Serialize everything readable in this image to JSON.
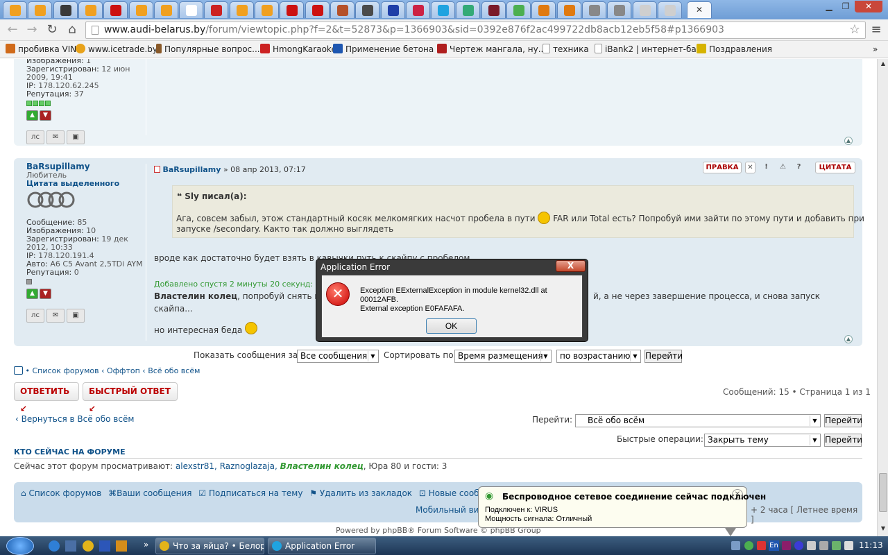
{
  "browser": {
    "tabs_count": 27,
    "url_host": "www.audi-belarus.by",
    "url_path": "/forum/viewtopic.php?f=2&t=52873&p=1366903&sid=0392e876f2ac499722db8acb12eb5f58#p1366903",
    "bookmarks": [
      {
        "label": "пробивка VIN",
        "color": "#d06a1a"
      },
      {
        "label": "www.icetrade.by",
        "color": "#e8a21a"
      },
      {
        "label": "Популярные вопрос...",
        "color": "#8a5a2a"
      },
      {
        "label": "HmongKaraoke",
        "color": "#cc2222"
      },
      {
        "label": "Применение бетона ...",
        "color": "#1e56b0"
      },
      {
        "label": "Чертеж мангала, ну...",
        "color": "#b01e1e"
      },
      {
        "label": "техника",
        "color": "#ffffff"
      },
      {
        "label": "iBank2 | интернет-ба...",
        "color": "#ffffff"
      },
      {
        "label": "Поздравления",
        "color": "#d6b300"
      }
    ]
  },
  "post1": {
    "images_label": "Изображения:",
    "images_value": "1",
    "registered_label": "Зарегистрирован:",
    "registered_value": "12 июн",
    "registered_value2": "2009, 19:41",
    "ip_label": "IP:",
    "ip_value": "178.120.62.245",
    "rep_label": "Репутация:",
    "rep_value": "37"
  },
  "post2": {
    "author": "BaRsupillamy",
    "rank": "Любитель",
    "group": "Цитата выделенного",
    "messages_label": "Сообщение:",
    "messages_value": "85",
    "images_label": "Изображения:",
    "images_value": "10",
    "registered_label": "Зарегистрирован:",
    "registered_value": "19 дек",
    "registered_value2": "2012, 10:33",
    "ip_label": "IP:",
    "ip_value": "178.120.191.4",
    "car_label": "Авто:",
    "car_value": "A6 C5 Avant 2,5TDi AYM",
    "rep_label": "Репутация:",
    "rep_value": "0",
    "header_author": "BaRsupillamy",
    "header_date": "» 08 апр 2013, 07:17",
    "btn_edit": "ПРАВКА",
    "btn_quote": "ЦИТАТА",
    "quote_author": "Sly писал(а):",
    "quote_text1": "Ага, совсем забыл, этож стандартный косяк мелкомягких насчот пробела в пути",
    "quote_text1b": "FAR или Total есть? Попробуй ими зайти по этому пути и добавить при",
    "quote_text2": "запуске /secondary. Както так должно выглядеть",
    "text1": "вроде как достаточно будет взять в кавычки путь к скайпу с пробелом",
    "added": "Добавлено спустя 2 минуты 20 секунд:",
    "mention": "Властелин колец",
    "text2a": ", попробуй снять п",
    "text2b": "й, а не через завершение процесса, и снова запуск",
    "text2c": "скайпа...",
    "text3": "но интересная беда"
  },
  "sortbar": {
    "show_label": "Показать сообщения за:",
    "show_value": "Все сообщения",
    "sort_label": "Сортировать по:",
    "sort_value": "Время размещения",
    "order_value": "по возрастанию",
    "go": "Перейти"
  },
  "breadcrumb": [
    "Список форумов",
    "Оффтоп",
    "Всё обо всём"
  ],
  "actions": {
    "reply": "ОТВЕТИТЬ",
    "quick_reply": "БЫСТРЫЙ ОТВЕТ",
    "pagination": "Сообщений: 15 • Страница 1 из 1"
  },
  "jump": {
    "back": "Вернуться в Всё обо всём",
    "goto_label": "Перейти:",
    "goto_value": "Всё обо всём",
    "go": "Перейти",
    "quick_label": "Быстрые операции:",
    "quick_value": "Закрыть тему"
  },
  "online": {
    "title": "КТО СЕЙЧАС НА ФОРУМЕ",
    "prefix": "Сейчас этот форум просматривают:",
    "users": "alexstr81, Raznoglazaja,",
    "mod": "Властелин колец",
    "suffix": ", Юра 80 и гости: 3"
  },
  "footer": {
    "forums": "Список форумов",
    "your_posts": "Ваши сообщения",
    "subscribe": "Подписаться на тему",
    "remove_bm": "Удалить из закладок",
    "new_posts": "Новые сообщения",
    "mobile": "Мобильный вид",
    "tz": "+ 2 часа [ Летнее время ]",
    "powered": "Powered by phpBB® Forum Software © phpBB Group"
  },
  "dialog": {
    "title": "Application Error",
    "close": "X",
    "line1": "Exception EExternalException in module kernel32.dll at 00012AFB.",
    "line2": "External exception E0FAFAFA.",
    "ok": "OK"
  },
  "notification": {
    "title": "Беспроводное сетевое соединение сейчас подключен",
    "line1": "Подключен к: VIRUS",
    "line2": "Мощность сигнала: Отличный"
  },
  "taskbar": {
    "task1": "Что за яйца? • Белор...",
    "task2": "Application Error",
    "clock": "11:13",
    "lang": "En"
  }
}
